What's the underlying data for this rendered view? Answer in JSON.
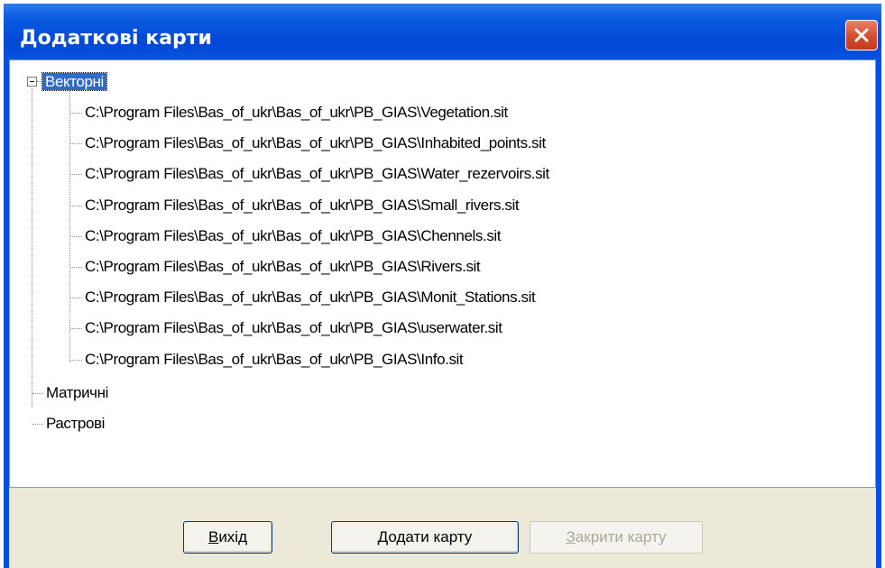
{
  "window": {
    "title": "Додаткові карти"
  },
  "tree": {
    "root": {
      "label": "Векторні",
      "expanded": true,
      "selected": true,
      "children": [
        "C:\\Program Files\\Bas_of_ukr\\Bas_of_ukr\\PB_GIAS\\Vegetation.sit",
        "C:\\Program Files\\Bas_of_ukr\\Bas_of_ukr\\PB_GIAS\\Inhabited_points.sit",
        "C:\\Program Files\\Bas_of_ukr\\Bas_of_ukr\\PB_GIAS\\Water_rezervoirs.sit",
        "C:\\Program Files\\Bas_of_ukr\\Bas_of_ukr\\PB_GIAS\\Small_rivers.sit",
        "C:\\Program Files\\Bas_of_ukr\\Bas_of_ukr\\PB_GIAS\\Chennels.sit",
        "C:\\Program Files\\Bas_of_ukr\\Bas_of_ukr\\PB_GIAS\\Rivers.sit",
        "C:\\Program Files\\Bas_of_ukr\\Bas_of_ukr\\PB_GIAS\\Monit_Stations.sit",
        "C:\\Program Files\\Bas_of_ukr\\Bas_of_ukr\\PB_GIAS\\userwater.sit",
        "C:\\Program Files\\Bas_of_ukr\\Bas_of_ukr\\PB_GIAS\\Info.sit"
      ]
    },
    "nodes": [
      "Матричні",
      "Растрові"
    ]
  },
  "buttons": {
    "exit": {
      "hotkey": "В",
      "rest": "ихід"
    },
    "add": {
      "hotkey": "Д",
      "rest": "одати карту"
    },
    "close": {
      "hotkey": "З",
      "rest": "акрити карту",
      "disabled": true
    }
  },
  "icons": {
    "close": "close-x-icon",
    "expander": "minus-box-icon"
  },
  "colors": {
    "titlebar": "#0054e3",
    "selection": "#316ac5",
    "dialog": "#ece9d8",
    "close_button": "#d34d2f"
  }
}
